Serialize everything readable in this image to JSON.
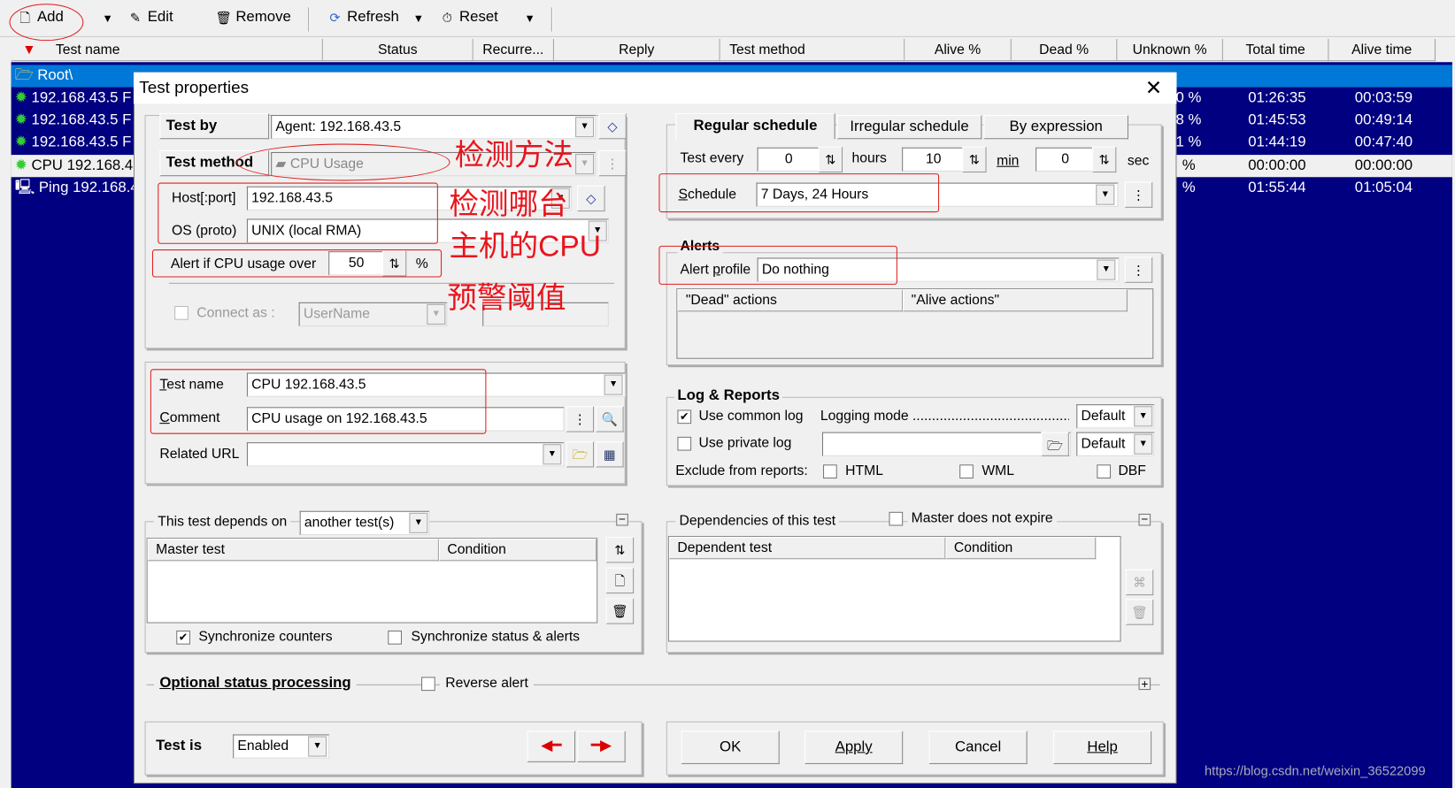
{
  "toolbar": {
    "add": "Add",
    "edit": "Edit",
    "remove": "Remove",
    "refresh": "Refresh",
    "reset": "Reset"
  },
  "columns": [
    "Test name",
    "Status",
    "Recurre...",
    "Reply",
    "Test method",
    "Alive %",
    "Dead %",
    "Unknown %",
    "Total time",
    "Alive time"
  ],
  "rows": [
    {
      "name": "Root\\",
      "unknown": "",
      "total": "",
      "alive": "",
      "icon": "folder-icon"
    },
    {
      "name": "192.168.43.5 F",
      "unknown": "0 %",
      "total": "01:26:35",
      "alive": "00:03:59",
      "icon": "bulb-icon"
    },
    {
      "name": "192.168.43.5 F",
      "unknown": "8 %",
      "total": "01:45:53",
      "alive": "00:49:14",
      "icon": "bulb-icon"
    },
    {
      "name": "192.168.43.5 F",
      "unknown": "1 %",
      "total": "01:44:19",
      "alive": "00:47:40",
      "icon": "bulb-icon"
    },
    {
      "name": "CPU 192.168.4",
      "unknown": "%",
      "total": "00:00:00",
      "alive": "00:00:00",
      "icon": "bulb-icon"
    },
    {
      "name": "Ping 192.168.4",
      "unknown": "%",
      "total": "01:55:44",
      "alive": "01:05:04",
      "icon": "computer-icon"
    }
  ],
  "dialog": {
    "title": "Test properties",
    "test_by_label": "Test by",
    "test_by_value": "Agent: 192.168.43.5",
    "test_method_label": "Test method",
    "test_method_value": "CPU Usage",
    "host_label": "Host[:port]",
    "host_value": "192.168.43.5",
    "os_label": "OS (proto)",
    "os_value": "UNIX (local RMA)",
    "alert_cpu_label": "Alert if CPU usage over",
    "alert_cpu_value": "50",
    "alert_cpu_unit": "%",
    "connect_as_label": "Connect as :",
    "connect_as_user": "UserName",
    "test_name_label": "Test name",
    "test_name_value": "CPU 192.168.43.5",
    "comment_label": "Comment",
    "comment_value": "CPU usage on 192.168.43.5",
    "related_url_label": "Related URL",
    "related_url_value": "",
    "schedule_tabs": [
      "Regular schedule",
      "Irregular schedule",
      "By expression"
    ],
    "test_every_label": "Test every",
    "hours_value": "0",
    "hours_label": "hours",
    "min_value": "10",
    "min_label": "min",
    "sec_value": "0",
    "sec_label": "sec",
    "schedule_label": "Schedule",
    "schedule_value": "7 Days, 24 Hours",
    "alerts_title": "Alerts",
    "alert_profile_label": "Alert profile",
    "alert_profile_value": "Do nothing",
    "dead_actions": "\"Dead\" actions",
    "alive_actions": "\"Alive actions\"",
    "log_title": "Log & Reports",
    "use_common_log": "Use common log",
    "use_common_log_checked": true,
    "logging_mode": "Logging mode ...........................................",
    "logging_mode_value": "Default",
    "use_private_log": "Use private log",
    "use_private_log_checked": false,
    "private_log_value": "Default",
    "exclude_label": "Exclude from reports:",
    "html": "HTML",
    "wml": "WML",
    "dbf": "DBF",
    "depends_label": "This test depends on",
    "depends_value": "another test(s)",
    "master_test_col": "Master test",
    "condition_col": "Condition",
    "sync_counters": "Synchronize counters",
    "sync_counters_checked": true,
    "sync_status": "Synchronize status & alerts",
    "sync_status_checked": false,
    "deps_label": "Dependencies of this test",
    "master_not_expire": "Master does not expire",
    "dependent_test_col": "Dependent test",
    "condition_col2": "Condition",
    "optional_label": "Optional status processing",
    "reverse_alert": "Reverse alert",
    "test_is_label": "Test is",
    "test_is_value": "Enabled",
    "ok": "OK",
    "apply": "Apply",
    "cancel": "Cancel",
    "help": "Help"
  },
  "annotations": {
    "method": "检测方法",
    "host1": "检测哪台",
    "host2": "主机的CPU",
    "threshold": "预警阈值"
  },
  "watermark": "https://blog.csdn.net/weixin_36522099",
  "colors": {
    "list_bg": "#000080",
    "selected": "#0078d7",
    "annotation": "#e8141c"
  }
}
